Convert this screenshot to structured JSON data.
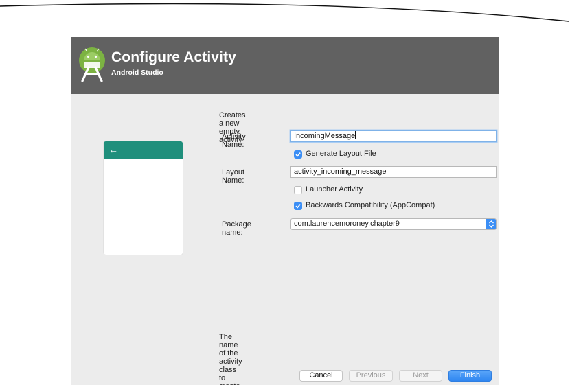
{
  "header": {
    "title": "Configure Activity",
    "subtitle": "Android Studio",
    "bg_color": "#616161",
    "logo_icon": "android-studio-logo"
  },
  "preview": {
    "bar_color": "#1f8f7c",
    "back_glyph": "←"
  },
  "form": {
    "description": "Creates a new empty activity",
    "activity_name": {
      "label": "Activity Name:",
      "value": "IncomingMessage"
    },
    "generate_layout": {
      "label": "Generate Layout File",
      "checked": true
    },
    "layout_name": {
      "label": "Layout Name:",
      "value": "activity_incoming_message"
    },
    "launcher_activity": {
      "label": "Launcher Activity",
      "checked": false
    },
    "backwards_compat": {
      "label": "Backwards Compatibility (AppCompat)",
      "checked": true
    },
    "package_name": {
      "label": "Package name:",
      "value": "com.laurencemoroney.chapter9"
    }
  },
  "hint": "The name of the activity class to create",
  "buttons": {
    "cancel": "Cancel",
    "previous": "Previous",
    "next": "Next",
    "finish": "Finish"
  },
  "accent_color": "#3b8ef5"
}
